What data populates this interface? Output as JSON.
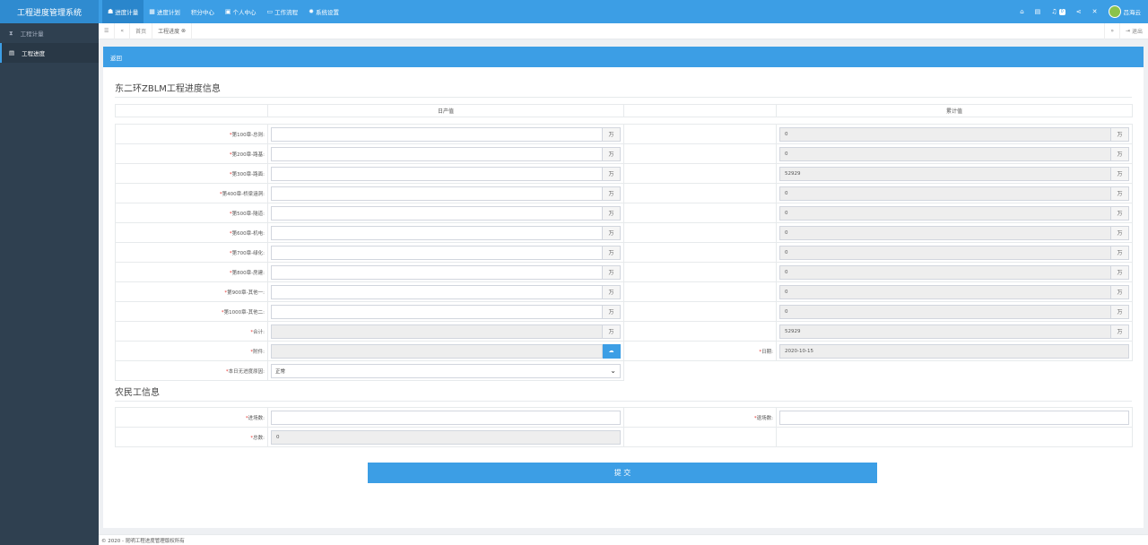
{
  "app": {
    "title": "工程进度管理系统"
  },
  "topnav": [
    {
      "icon": "☗",
      "label": "进度计量"
    },
    {
      "icon": "▦",
      "label": "进度计划"
    },
    {
      "icon": "",
      "label": "积分中心"
    },
    {
      "icon": "▣",
      "label": "个人中心"
    },
    {
      "icon": "▭",
      "label": "工作流程"
    },
    {
      "icon": "✹",
      "label": "系统设置"
    }
  ],
  "topright": {
    "notifications_count": "0",
    "user_name": "吕海云"
  },
  "sidebar": {
    "items": [
      {
        "label": "工程计量"
      },
      {
        "label": "工程进度"
      }
    ]
  },
  "tabs": {
    "home": "首页",
    "current": "工程进度",
    "logout": "退出"
  },
  "card": {
    "back_label": "返回"
  },
  "progress": {
    "title": "东二环ZBLM工程进度信息",
    "col_daily": "日产值",
    "col_total": "累计值",
    "unit": "万",
    "rows": [
      {
        "label": "第100章-总则:",
        "daily": "",
        "total": "0"
      },
      {
        "label": "第200章-路基:",
        "daily": "",
        "total": "0"
      },
      {
        "label": "第300章-路面:",
        "daily": "",
        "total": "52929"
      },
      {
        "label": "第400章-桥梁涵洞:",
        "daily": "",
        "total": "0"
      },
      {
        "label": "第500章-隧道:",
        "daily": "",
        "total": "0"
      },
      {
        "label": "第600章-机电:",
        "daily": "",
        "total": "0"
      },
      {
        "label": "第700章-绿化:",
        "daily": "",
        "total": "0"
      },
      {
        "label": "第800章-房建:",
        "daily": "",
        "total": "0"
      },
      {
        "label": "第900章-其他一:",
        "daily": "",
        "total": "0"
      },
      {
        "label": "第1000章-其他二:",
        "daily": "",
        "total": "0"
      },
      {
        "label": "合计:",
        "daily": "",
        "total": "52929"
      }
    ],
    "attachment_label": "附件:",
    "date_label": "日期:",
    "date_value": "2020-10-15",
    "status_label": "本日无进度原因:",
    "status_value": "正常"
  },
  "workers": {
    "title": "农民工信息",
    "enter_label": "进场数:",
    "enter_value": "",
    "exit_label": "退场数:",
    "exit_value": "",
    "total_label": "总数:",
    "total_value": "0"
  },
  "submit_label": "提 交",
  "footer": "© 2020 - 昆明工程进度管理版权所有",
  "colors": {
    "primary": "#3c9ee5",
    "sidebar": "#2f4050",
    "required": "#e53935"
  }
}
